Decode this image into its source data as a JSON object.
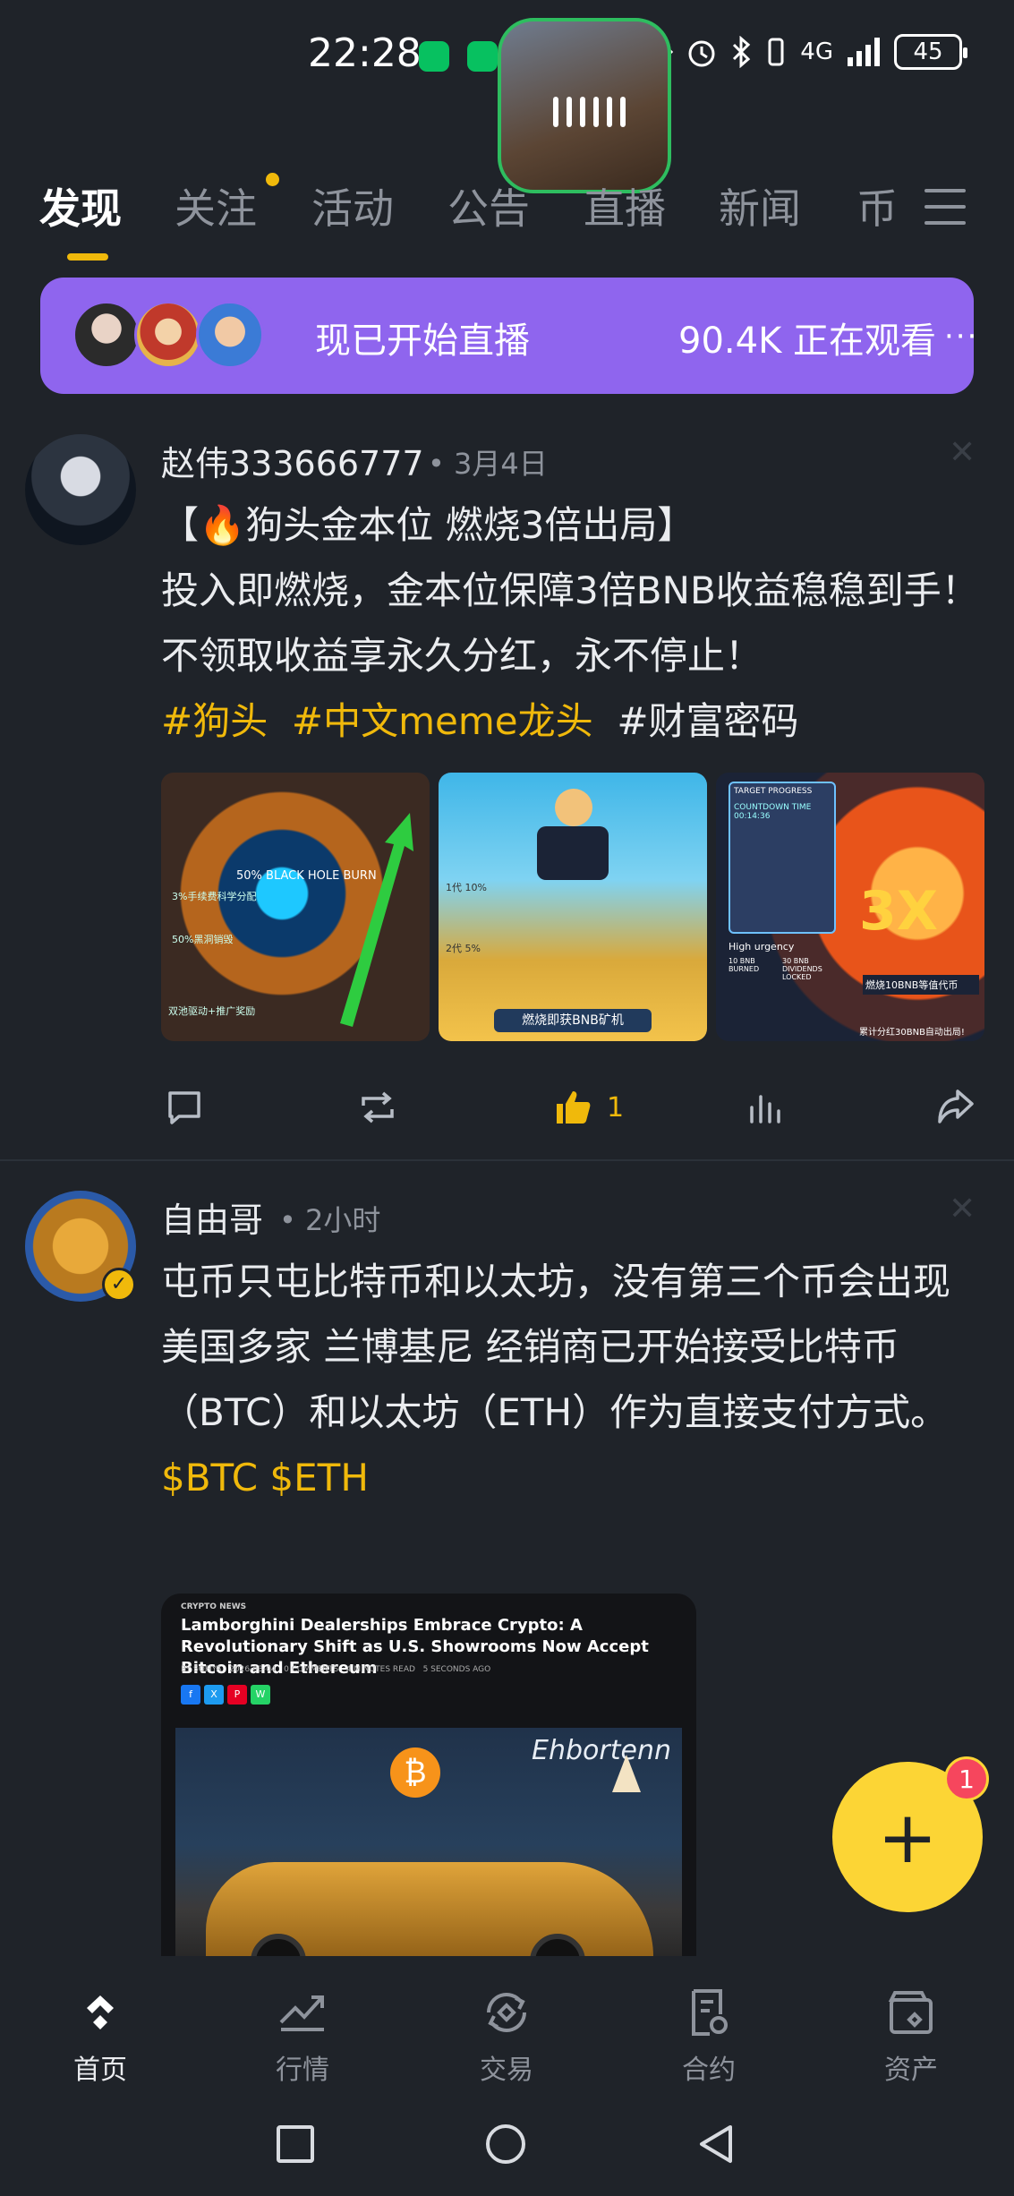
{
  "status_bar": {
    "time": "22:28",
    "network": "4G",
    "battery": "45",
    "icons": [
      "wechat-icon",
      "wechat-icon",
      "red-app-icon",
      "red-app-icon",
      "browser-icon",
      "eye-icon",
      "alarm-icon",
      "bluetooth-icon",
      "vibrate-icon",
      "signal-icon",
      "battery-icon"
    ]
  },
  "tabs": [
    "发现",
    "关注",
    "活动",
    "公告",
    "直播",
    "新闻",
    "币"
  ],
  "live_banner": {
    "text": "现已开始直播",
    "viewers": "90.4K 正在观看",
    "more": "···"
  },
  "posts": [
    {
      "author": "赵伟333666777",
      "time": "3月4日",
      "title_line": "【🔥狗头金本位 燃烧3倍出局】",
      "body": "投入即燃烧，金本位保障3倍BNB收益稳稳到手！不领取收益享永久分红，永不停止！",
      "tags": [
        "#狗头",
        "#中文meme龙头",
        "#财富密码"
      ],
      "images": [
        {
          "label": "50% BLACK HOLE BURN",
          "sub": "3%手续费科学分配",
          "sub2": "50%黑洞销毁",
          "sub3": "双池驱动+推广奖励"
        },
        {
          "label": "燃烧即获BNB矿机",
          "sub": "1代 10%",
          "sub2": "2代 5%"
        },
        {
          "label": "燃烧10BNB等值代币",
          "sub": "TARGET PROGRESS",
          "sub2": "COUNTDOWN TIME 00:14:36",
          "sub3": "3X",
          "sub4": "High urgency",
          "sub5": "10 BNB BURNED",
          "sub6": "30 BNB DIVIDENDS LOCKED",
          "sub7": "累计分红30BNB自动出局!"
        }
      ],
      "actions": {
        "comment": "",
        "repost": "",
        "like": "1",
        "stats": "",
        "share": ""
      }
    },
    {
      "author": "自由哥",
      "time": "2小时",
      "body_line1": "屯币只屯比特币和以太坊，没有第三个币会出现",
      "body_line2": "美国多家 兰博基尼 经销商已开始接受比特币（BTC）和以太坊（ETH）作为直接支付方式。",
      "cashtags": [
        "$BTC",
        "$ETH"
      ],
      "news_card": {
        "category": "CRYPTO NEWS",
        "title": "Lamborghini Dealerships Embrace Crypto: A Revolutionary Shift as U.S. Showrooms Now Accept Bitcoin and Ethereum",
        "byline": "BY SOFIYA",
        "date": "2026-03-04",
        "comments": "0 COMMENTS",
        "read_time": "4 MINUTES READ",
        "ago": "5 SECONDS AGO",
        "share_buttons": [
          "f",
          "X",
          "P",
          "W"
        ],
        "sign_text": "Ehbortenn"
      }
    }
  ],
  "fab": {
    "symbol": "+",
    "badge": "1"
  },
  "bottom_nav": [
    {
      "label": "首页",
      "icon": "home-icon"
    },
    {
      "label": "行情",
      "icon": "markets-icon"
    },
    {
      "label": "交易",
      "icon": "trade-icon"
    },
    {
      "label": "合约",
      "icon": "futures-icon"
    },
    {
      "label": "资产",
      "icon": "wallet-icon"
    }
  ],
  "colors": {
    "background": "#1f2329",
    "accent": "#f0b90b",
    "live_banner": "#8f65ee",
    "fab": "#fcd535",
    "badge": "#f6465d"
  }
}
